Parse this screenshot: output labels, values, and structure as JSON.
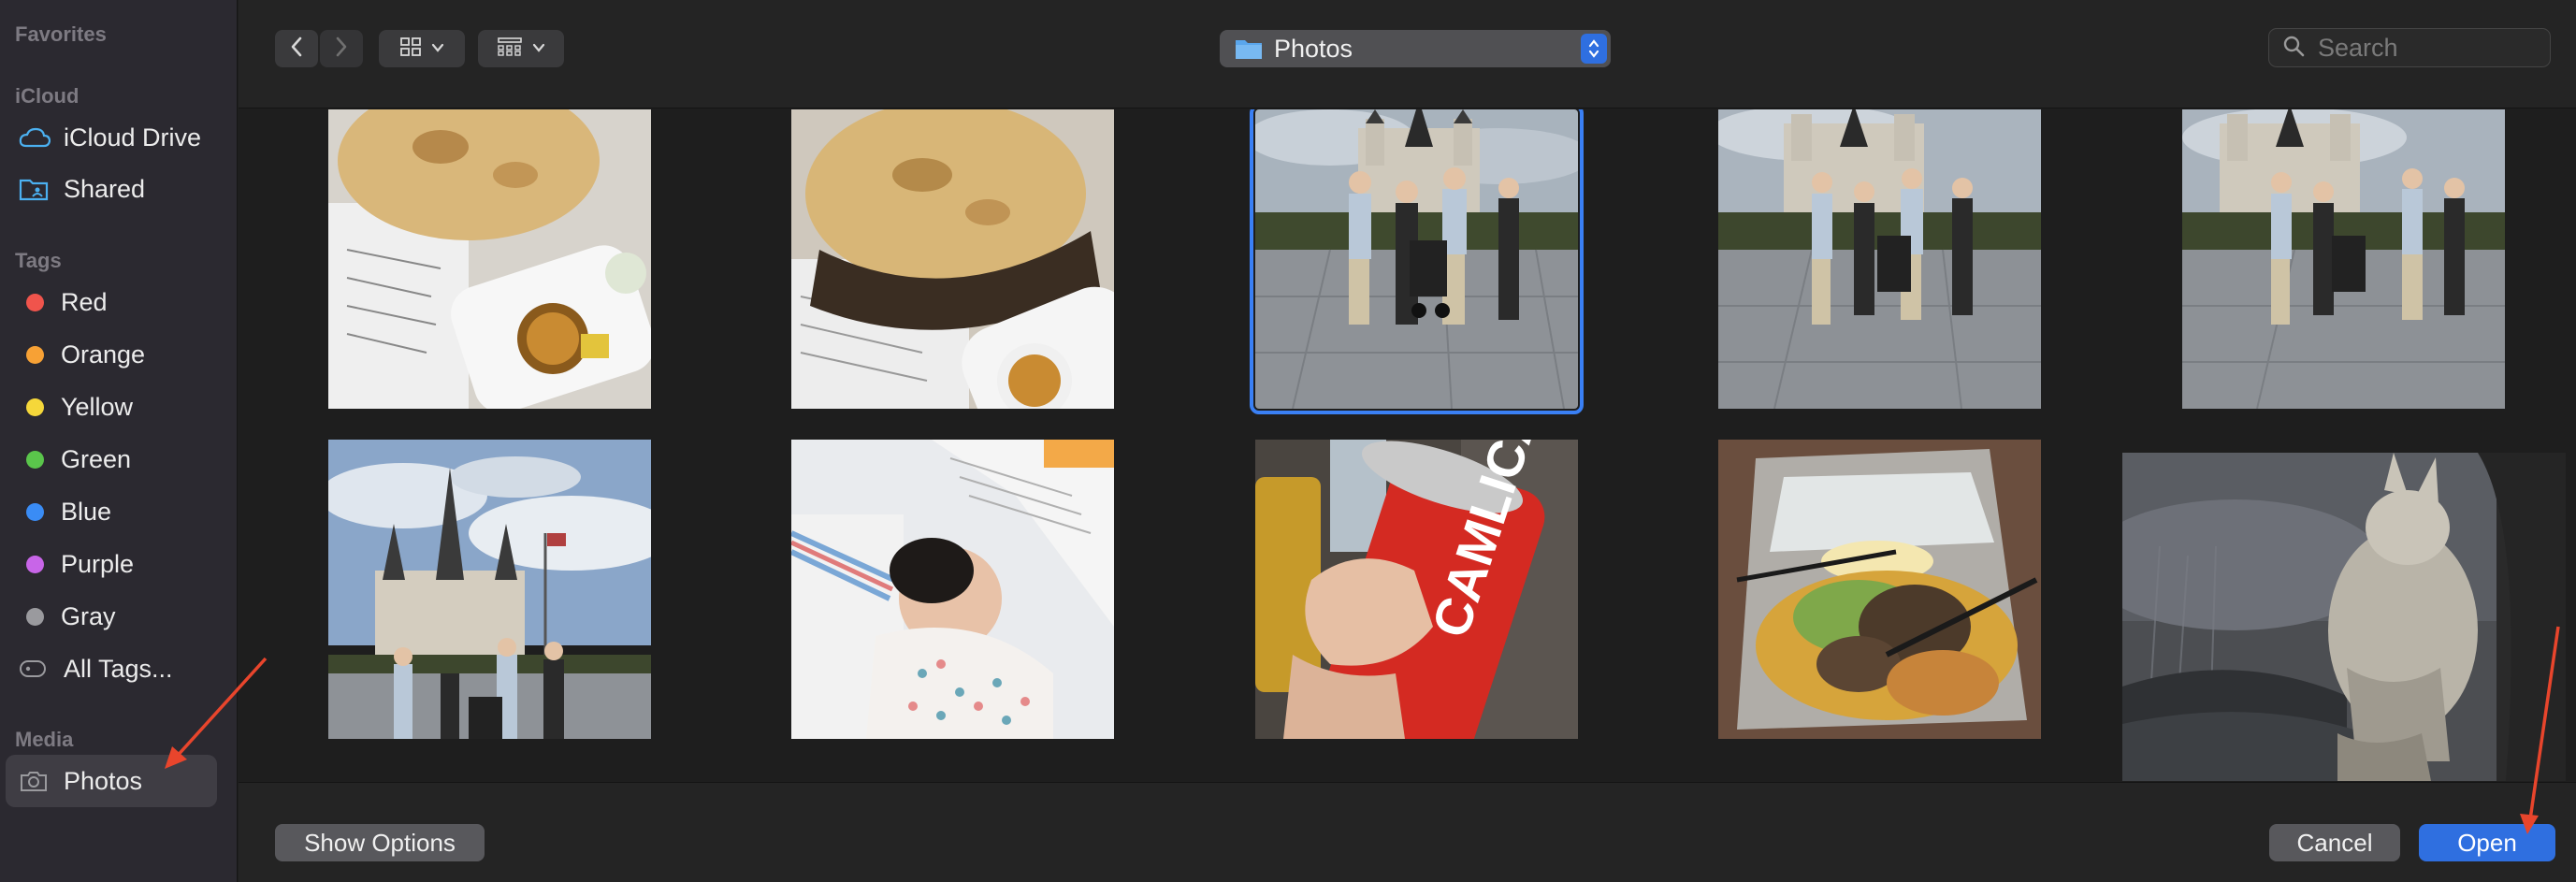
{
  "sidebar": {
    "favorites_heading": "Favorites",
    "icloud_heading": "iCloud",
    "icloud_items": [
      {
        "label": "iCloud Drive",
        "icon": "cloud-icon"
      },
      {
        "label": "Shared",
        "icon": "shared-folder-icon"
      }
    ],
    "tags_heading": "Tags",
    "tags": [
      {
        "label": "Red",
        "color": "#f0544c"
      },
      {
        "label": "Orange",
        "color": "#f7a135"
      },
      {
        "label": "Yellow",
        "color": "#f5d73a"
      },
      {
        "label": "Green",
        "color": "#5ac54b"
      },
      {
        "label": "Blue",
        "color": "#3a8cf5"
      },
      {
        "label": "Purple",
        "color": "#c865e8"
      },
      {
        "label": "Gray",
        "color": "#9a9a9e"
      }
    ],
    "all_tags_label": "All Tags...",
    "media_heading": "Media",
    "media_items": [
      {
        "label": "Photos",
        "icon": "camera-icon",
        "selected": true
      }
    ]
  },
  "toolbar": {
    "location_label": "Photos",
    "search_placeholder": "Search"
  },
  "grid": {
    "photos": [
      {
        "name": "bread-with-sauces-1",
        "icon": "photo-thumbnail"
      },
      {
        "name": "bread-with-sauces-2",
        "icon": "photo-thumbnail"
      },
      {
        "name": "cathedral-group-1",
        "icon": "photo-thumbnail",
        "selected": true
      },
      {
        "name": "cathedral-group-2",
        "icon": "photo-thumbnail"
      },
      {
        "name": "cathedral-group-3",
        "icon": "photo-thumbnail"
      },
      {
        "name": "cathedral-group-4",
        "icon": "photo-thumbnail"
      },
      {
        "name": "baby-sleeping",
        "icon": "photo-thumbnail"
      },
      {
        "name": "camlica-can",
        "icon": "photo-thumbnail"
      },
      {
        "name": "takeout-food",
        "icon": "photo-thumbnail"
      },
      {
        "name": "wolf-artwork",
        "icon": "photo-thumbnail"
      }
    ],
    "can_text": "CAMLICA"
  },
  "footer": {
    "show_options_label": "Show Options",
    "cancel_label": "Cancel",
    "open_label": "Open"
  },
  "colors": {
    "accent": "#2f6fe0",
    "selection_outline": "#3a80f5",
    "annotation_arrow": "#e8452c"
  }
}
